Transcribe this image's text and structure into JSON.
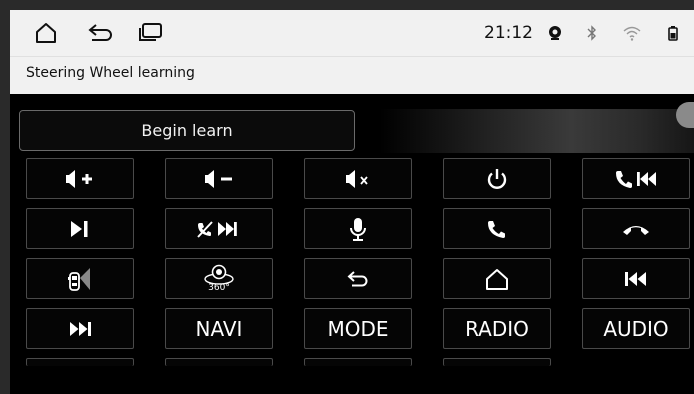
{
  "status_bar": {
    "time": "21:12",
    "nav_icons": [
      "home-icon",
      "back-icon",
      "recent-apps-icon"
    ],
    "status_icons": [
      "location-icon",
      "bluetooth-icon",
      "wifi-icon",
      "battery-icon"
    ]
  },
  "header": {
    "title": "Steering Wheel learning"
  },
  "main": {
    "begin_label": "Begin learn",
    "keys": [
      {
        "icon": "volume-up-icon"
      },
      {
        "icon": "volume-down-icon"
      },
      {
        "icon": "mute-icon"
      },
      {
        "icon": "power-icon"
      },
      {
        "icon": "call-previous-icon"
      },
      {
        "icon": "play-pause-icon"
      },
      {
        "icon": "hangup-next-icon"
      },
      {
        "icon": "microphone-icon"
      },
      {
        "icon": "phone-answer-icon"
      },
      {
        "icon": "phone-hangup-icon"
      },
      {
        "icon": "car-sound-icon"
      },
      {
        "icon": "camera-360-icon",
        "text": "360°"
      },
      {
        "icon": "back-arrow-icon"
      },
      {
        "icon": "home-icon"
      },
      {
        "icon": "previous-track-icon"
      },
      {
        "icon": "next-track-icon"
      },
      {
        "label": "NAVI"
      },
      {
        "label": "MODE"
      },
      {
        "label": "RADIO"
      },
      {
        "label": "AUDIO"
      }
    ]
  }
}
